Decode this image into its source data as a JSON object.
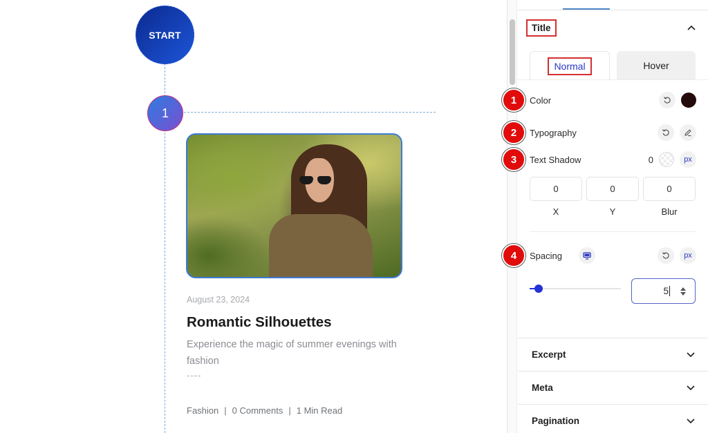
{
  "canvas": {
    "start_label": "START",
    "step_number": "1",
    "post": {
      "image_alt": "Woman in sunglasses and olive top outdoors among trees",
      "date": "August 23, 2024",
      "title": "Romantic Silhouettes",
      "excerpt": "Experience the magic of summer evenings with fashion",
      "separator": "----",
      "meta": {
        "category": "Fashion",
        "sep1": "|",
        "comments": "0 Comments",
        "sep2": "|",
        "read_time": "1 Min Read"
      }
    }
  },
  "panel": {
    "section_title": "Title",
    "state_tabs": [
      {
        "label": "Normal",
        "active": true
      },
      {
        "label": "Hover",
        "active": false
      }
    ],
    "controls": {
      "color": {
        "badge": "1",
        "label": "Color",
        "value": "#230a0b",
        "reset_icon": "reset-icon"
      },
      "typography": {
        "badge": "2",
        "label": "Typography",
        "reset_icon": "reset-icon",
        "edit_icon": "pencil-icon"
      },
      "text_shadow": {
        "badge": "3",
        "label": "Text Shadow",
        "value": "0",
        "unit": "px",
        "fields": [
          {
            "label": "X",
            "value": "0"
          },
          {
            "label": "Y",
            "value": "0"
          },
          {
            "label": "Blur",
            "value": "0"
          }
        ]
      },
      "spacing": {
        "badge": "4",
        "label": "Spacing",
        "device_icon": "desktop-icon",
        "unit": "px",
        "value": "5",
        "slider_fraction": 0.1
      }
    },
    "accordions": [
      {
        "label": "Excerpt",
        "expanded": false
      },
      {
        "label": "Meta",
        "expanded": false
      },
      {
        "label": "Pagination",
        "expanded": false
      }
    ]
  },
  "colors": {
    "accent": "#2332d6",
    "annotation_red": "#e10b0b",
    "highlight_box": "#d32f2f",
    "timeline_dash": "#7aa9d6"
  }
}
